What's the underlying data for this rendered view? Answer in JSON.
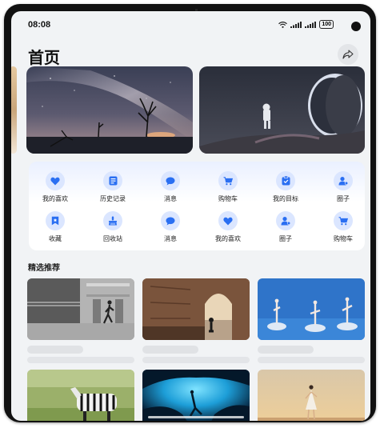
{
  "status": {
    "time": "08:08",
    "battery": "100"
  },
  "header": {
    "title": "首页",
    "share_icon": "share-icon"
  },
  "grid": {
    "row1": [
      {
        "label": "我的喜欢",
        "icon": "heart-icon"
      },
      {
        "label": "历史记录",
        "icon": "history-icon"
      },
      {
        "label": "消息",
        "icon": "message-icon"
      },
      {
        "label": "购物车",
        "icon": "cart-icon"
      },
      {
        "label": "我的目标",
        "icon": "goal-icon"
      },
      {
        "label": "圈子",
        "icon": "circle-icon"
      }
    ],
    "row2": [
      {
        "label": "收藏",
        "icon": "bookmark-icon"
      },
      {
        "label": "回收站",
        "icon": "recycle-icon"
      },
      {
        "label": "消息",
        "icon": "message-icon"
      },
      {
        "label": "我的喜欢",
        "icon": "heart-icon"
      },
      {
        "label": "圈子",
        "icon": "circle-icon"
      },
      {
        "label": "购物车",
        "icon": "cart-icon"
      }
    ]
  },
  "section": {
    "title": "精选推荐"
  },
  "colors": {
    "accent": "#2a6ff2",
    "icon_bg": "#dbe6ff",
    "background": "#f1f3f5"
  }
}
